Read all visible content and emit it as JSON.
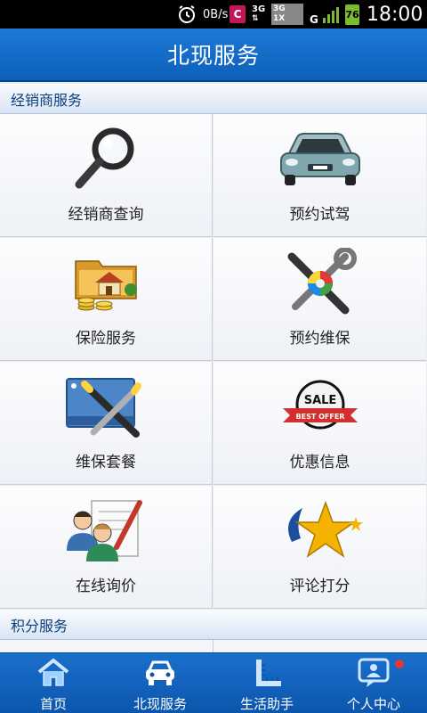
{
  "status_bar": {
    "speed": "0B/s",
    "c_badge": "C",
    "network_3g": "3G",
    "network_3g1x_top": "3G",
    "network_3g1x_bottom": "1X",
    "network_g": "G",
    "battery": "76",
    "time": "18:00"
  },
  "header": {
    "title": "北现服务"
  },
  "sections": [
    {
      "title": "经销商服务"
    },
    {
      "title": "积分服务"
    }
  ],
  "services": [
    {
      "label": "经销商查询",
      "icon": "magnifier-icon"
    },
    {
      "label": "预约试驾",
      "icon": "car-icon"
    },
    {
      "label": "保险服务",
      "icon": "house-folder-coins-icon"
    },
    {
      "label": "预约维保",
      "icon": "tools-icon"
    },
    {
      "label": "维保套餐",
      "icon": "wrench-screwdriver-card-icon"
    },
    {
      "label": "优惠信息",
      "icon": "sale-badge-icon"
    },
    {
      "label": "在线询价",
      "icon": "people-pencil-icon"
    },
    {
      "label": "评论打分",
      "icon": "star-icon"
    }
  ],
  "sale_badge": {
    "main": "SALE",
    "sub": "BEST OFFER"
  },
  "bottom_nav": [
    {
      "label": "首页",
      "icon": "home-icon"
    },
    {
      "label": "北现服务",
      "icon": "car-front-icon"
    },
    {
      "label": "生活助手",
      "icon": "ruler-icon"
    },
    {
      "label": "个人中心",
      "icon": "profile-chat-icon",
      "has_notification": true
    }
  ],
  "colors": {
    "header_blue": "#1d7ad6",
    "section_text": "#0a3e7e",
    "notification_red": "#e53935"
  }
}
